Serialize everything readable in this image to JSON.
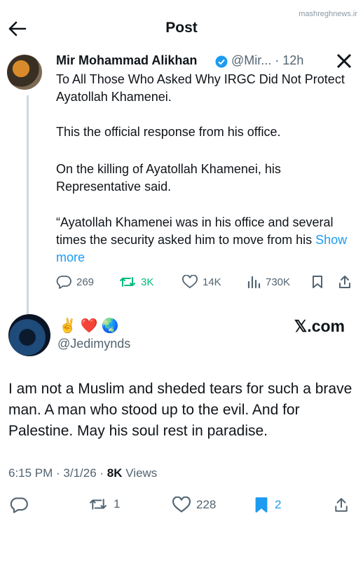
{
  "header": {
    "title": "Post",
    "watermark": "mashreghnews.ir"
  },
  "quoted_post": {
    "author_name": "Mir Mohammad Alikhan",
    "handle": "@Mir...",
    "time": "· 12h",
    "paragraphs": [
      "To All Those Who Asked Why IRGC Did Not Protect Ayatollah Khamenei.",
      "This the official response from his office.",
      "On the killing of Ayatollah Khamenei, his Representative said.",
      "“Ayatollah Khamenei was in his office and several times the security asked him to move from his"
    ],
    "show_more": "Show more",
    "stats": {
      "replies": "269",
      "reposts": "3K",
      "likes": "14K",
      "views": "730K"
    }
  },
  "reply_post": {
    "display_emojis": "✌️ ❤️ 🌏",
    "handle": "@Jedimynds",
    "x_badge": "𝕏.com",
    "text": "I am not a Muslim and sheded tears for such a brave man. A man who stood up to the evil. And for Palestine. May his soul rest in paradise.",
    "meta": {
      "time_date": "6:15 PM · 3/1/26 · ",
      "views_count": "8K",
      "views_label": " Views"
    },
    "stats": {
      "reposts": "1",
      "likes": "228",
      "bookmarks": "2"
    }
  },
  "colors": {
    "accent": "#1d9bf0",
    "repost_active": "#00ba7c",
    "muted": "#536471"
  }
}
